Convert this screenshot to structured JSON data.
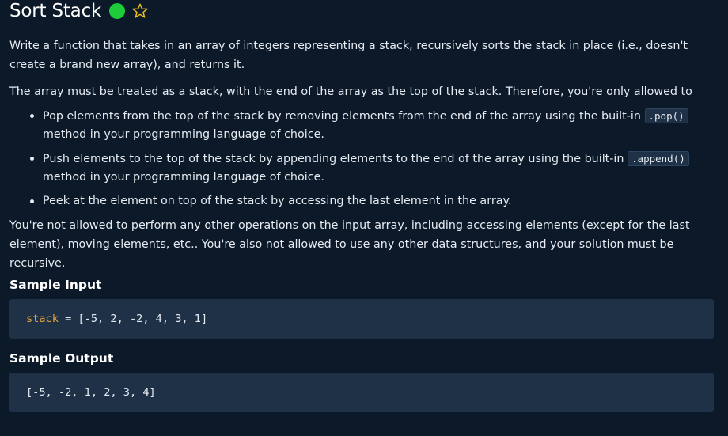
{
  "problem": {
    "title": "Sort Stack",
    "status_color": "#1ecb3a",
    "favorite_icon": "star-outline-icon"
  },
  "description": {
    "paragraph1": "Write a function that takes in an array of integers representing a stack, recursively sorts the stack in place (i.e., doesn't create a brand new array), and returns it.",
    "paragraph2": "The array must be treated as a stack, with the end of the array as the top of the stack. Therefore, you're only allowed to",
    "bullets": [
      {
        "before": "Pop elements from the top of the stack by removing elements from the end of the array using the built-in ",
        "code": ".pop()",
        "after": " method in your programming language of choice."
      },
      {
        "before": "Push elements to the top of the stack by appending elements to the end of the array using the built-in ",
        "code": ".append()",
        "after": " method in your programming language of choice."
      },
      {
        "text": "Peek at the element on top of the stack by accessing the last element in the array."
      }
    ],
    "paragraph3": "You're not allowed to perform any other operations on the input array, including accessing elements (except for the last element), moving elements, etc.. You're also not allowed to use any other data structures, and your solution must be recursive."
  },
  "sample_input": {
    "heading": "Sample Input",
    "var_name": "stack",
    "rest": " = [-5, 2, -2, 4, 3, 1]"
  },
  "sample_output": {
    "heading": "Sample Output",
    "value": "[-5, -2, 1, 2, 3, 4]"
  },
  "colors": {
    "background": "#0b1929",
    "code_background": "#1e3146",
    "variable": "#e8a23a"
  }
}
